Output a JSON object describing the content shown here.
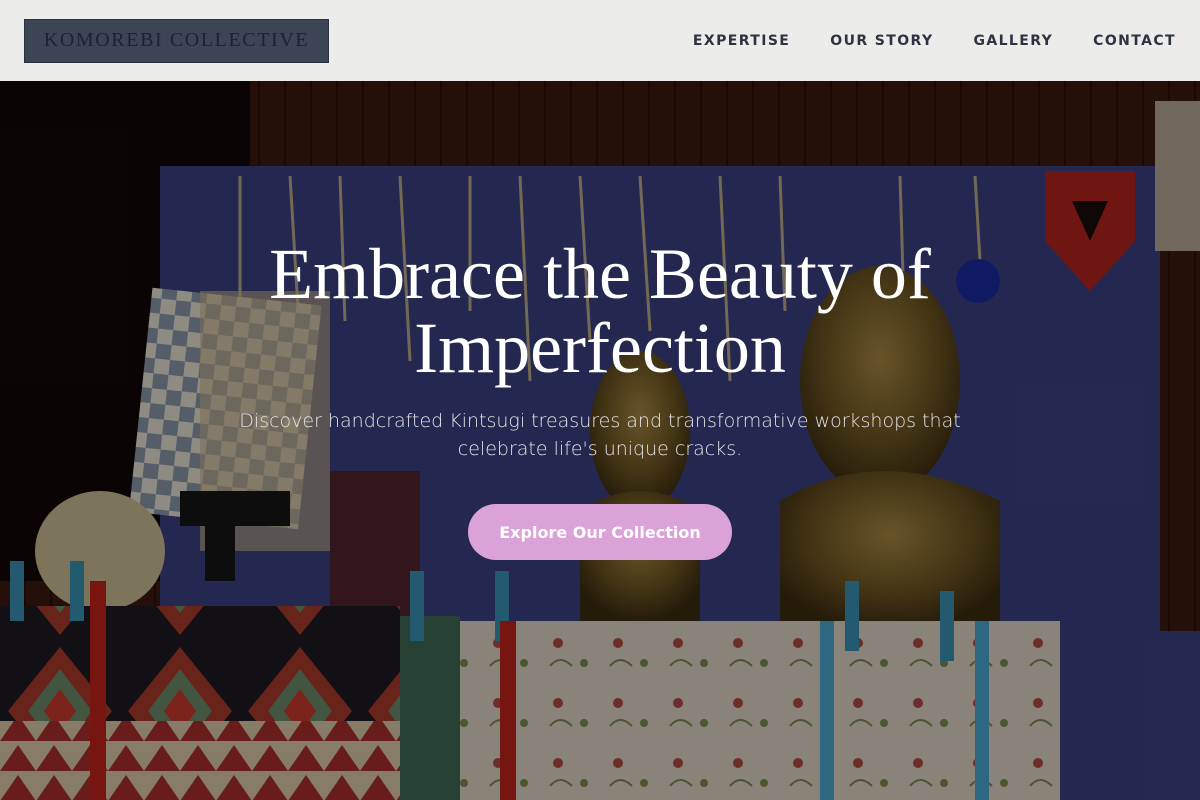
{
  "brand": {
    "name": "KOMOREBI COLLECTIVE"
  },
  "nav": {
    "items": [
      {
        "label": "EXPERTISE"
      },
      {
        "label": "OUR STORY"
      },
      {
        "label": "GALLERY"
      },
      {
        "label": "CONTACT"
      }
    ]
  },
  "hero": {
    "title_line1": "Embrace the Beauty of",
    "title_line2": "Imperfection",
    "subtitle_line1": "Discover handcrafted Kintsugi treasures and transformative workshops that",
    "subtitle_line2": "celebrate life's unique cracks.",
    "cta_label": "Explore Our Collection",
    "image_alt": "Market stall with embroidered textiles, bronze busts and hanging jewelry"
  },
  "colors": {
    "header_bg": "#ececeb",
    "logo_bg": "#3b4556",
    "nav_text": "#2d3340",
    "cta_bg": "#dba2d8",
    "title_text": "#ffffff"
  }
}
